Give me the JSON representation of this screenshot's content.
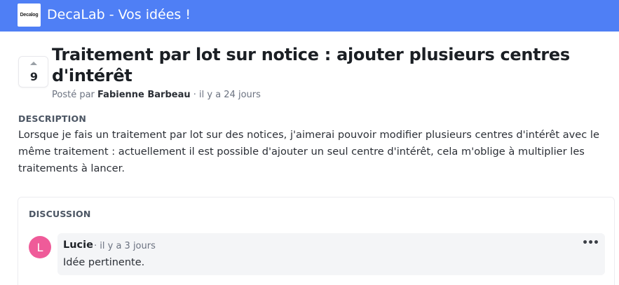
{
  "header": {
    "logo_text": "Decalog",
    "title": "DecaLab - Vos idées !",
    "bg_color": "#4f7ff5"
  },
  "post": {
    "votes": "9",
    "title": "Traitement par lot sur notice : ajouter plusieurs centres d'intérêt",
    "posted_by_prefix": "Posté par",
    "author": "Fabienne Barbeau",
    "time": "· il y a 24 jours"
  },
  "description": {
    "label": "DESCRIPTION",
    "text": "Lorsque je fais un traitement par lot sur des notices, j'aimerai pouvoir modifier plusieurs centres d'intérêt avec le même traitement : actuellement il est possible d'ajouter un seul centre d'intérêt, cela m'oblige à multiplier les traitements à lancer."
  },
  "discussion": {
    "label": "DISCUSSION",
    "comments": [
      {
        "avatar_letter": "L",
        "avatar_color": "#ef5b99",
        "author": "Lucie",
        "time": "· il y a 3 jours",
        "text": "Idée pertinente.",
        "menu_icon": "more-horizontal-icon",
        "menu_glyph": "•••"
      }
    ]
  }
}
